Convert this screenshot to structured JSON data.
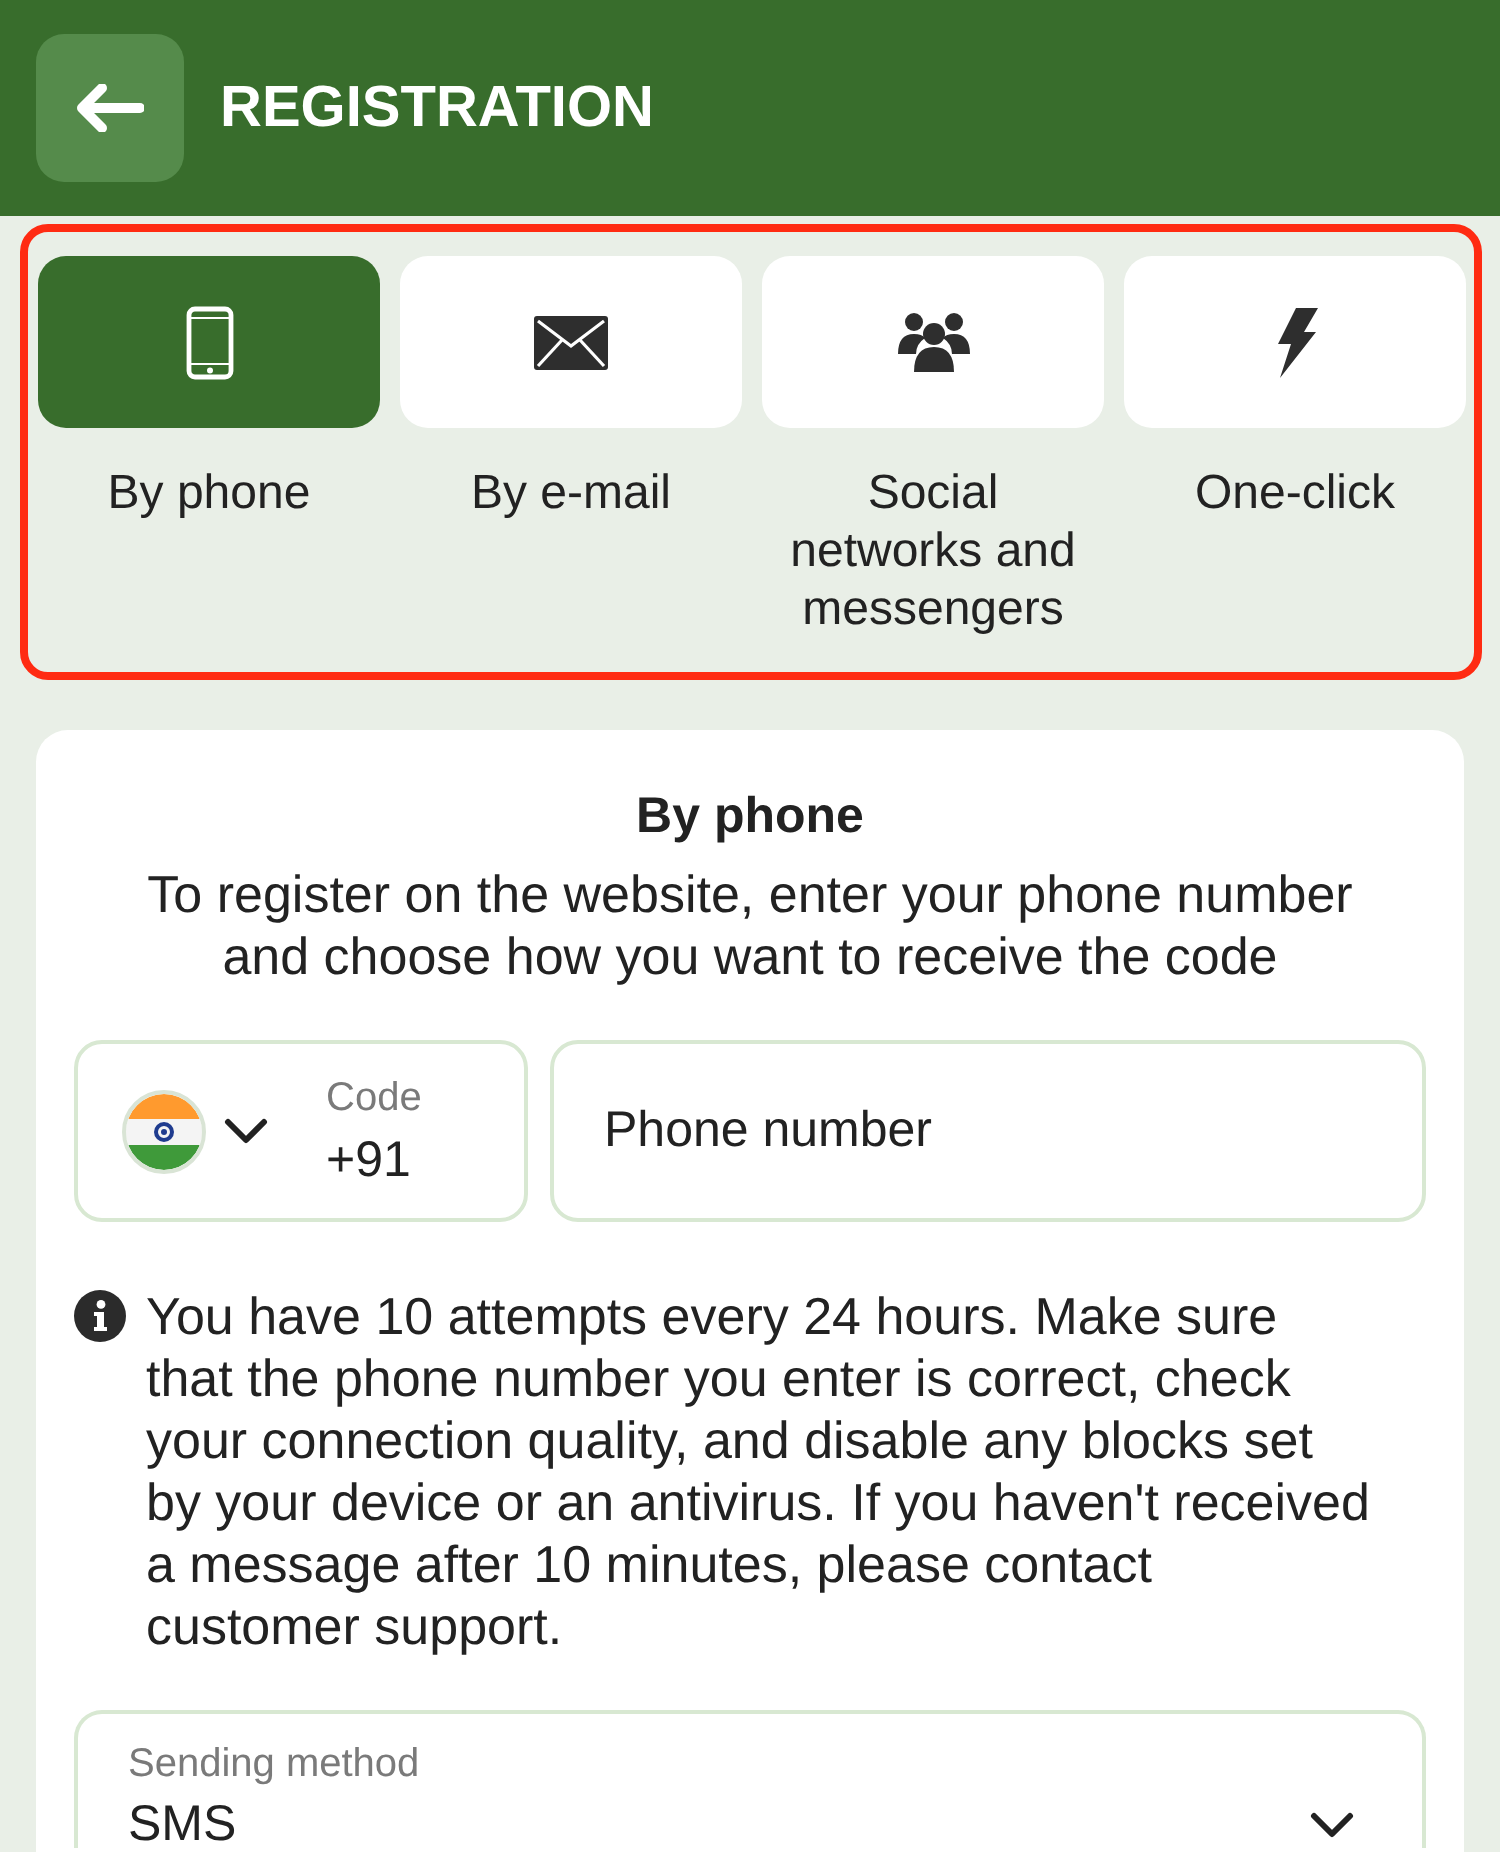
{
  "header": {
    "title": "REGISTRATION"
  },
  "methods": {
    "highlighted": true,
    "tabs": [
      {
        "kind": "phone",
        "label": "By phone",
        "selected": true
      },
      {
        "kind": "email",
        "label": "By e-mail",
        "selected": false
      },
      {
        "kind": "social",
        "label": "Social networks and messengers",
        "selected": false
      },
      {
        "kind": "one-click",
        "label": "One-click",
        "selected": false
      }
    ]
  },
  "form": {
    "title": "By phone",
    "description": "To register on the website, enter your phone number and choose how you want to receive the code",
    "country_code": {
      "label": "Code",
      "value": "+91"
    },
    "phone": {
      "placeholder": "Phone number"
    },
    "notice": "You have 10 attempts every 24 hours. Make sure that the phone number you enter is correct, check your connection quality, and disable any blocks set by your device or an antivirus. If you haven't received a message after 10 minutes, please contact customer support.",
    "sending_method": {
      "label": "Sending method",
      "value": "SMS"
    }
  }
}
